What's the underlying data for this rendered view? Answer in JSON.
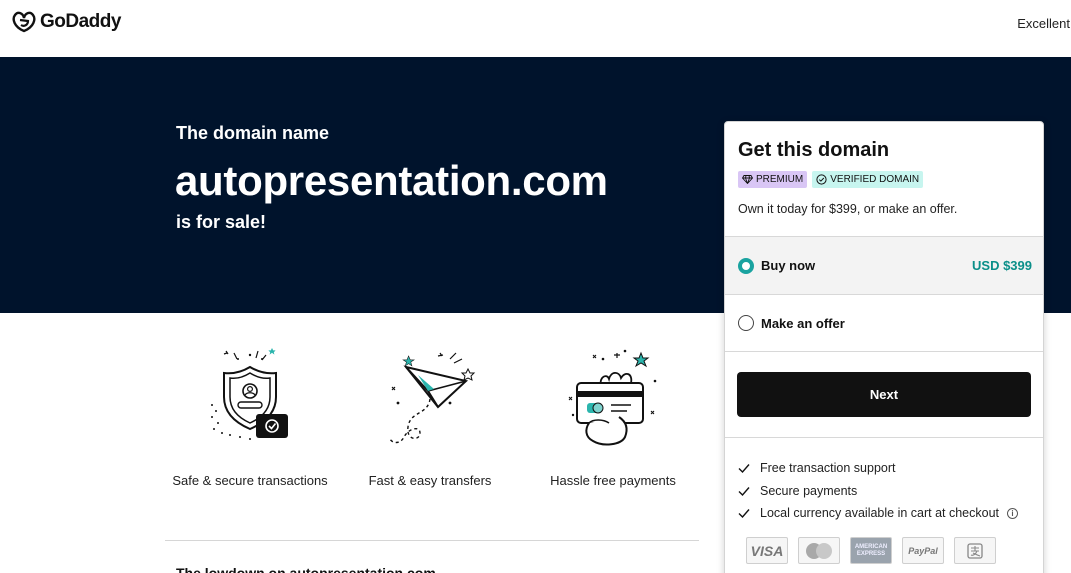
{
  "header": {
    "brand": "GoDaddy",
    "rating_label": "Excellent"
  },
  "hero": {
    "kicker": "The domain name",
    "domain": "autopresentation.com",
    "suffix": "is for sale!"
  },
  "features": [
    {
      "label": "Safe & secure transactions",
      "icon": "shield-lock-icon"
    },
    {
      "label": "Fast & easy transfers",
      "icon": "paper-plane-icon"
    },
    {
      "label": "Hassle free payments",
      "icon": "hand-card-icon"
    }
  ],
  "below": {
    "heading": "The lowdown on autopresentation.com"
  },
  "card": {
    "title": "Get this domain",
    "badges": {
      "premium": "PREMIUM",
      "verified": "VERIFIED DOMAIN"
    },
    "subtitle": "Own it today for $399, or make an offer.",
    "options": {
      "buy_label": "Buy now",
      "buy_price": "USD $399",
      "buy_selected": true,
      "offer_label": "Make an offer",
      "offer_selected": false
    },
    "next_label": "Next",
    "benefits": [
      "Free transaction support",
      "Secure payments",
      "Local currency available in cart at checkout"
    ],
    "payments": {
      "visa": "VISA",
      "amex": "AMERICAN EXPRESS",
      "paypal": "PayPal",
      "icons": [
        "visa-icon",
        "mastercard-icon",
        "amex-icon",
        "paypal-icon",
        "alipay-icon"
      ]
    }
  },
  "colors": {
    "hero_bg": "#00132c",
    "accent_teal": "#1aa3a0",
    "price_teal": "#0b8f89",
    "premium_badge": "#d9c6f5",
    "verified_badge": "#c7f5ef",
    "button_bg": "#111111"
  }
}
